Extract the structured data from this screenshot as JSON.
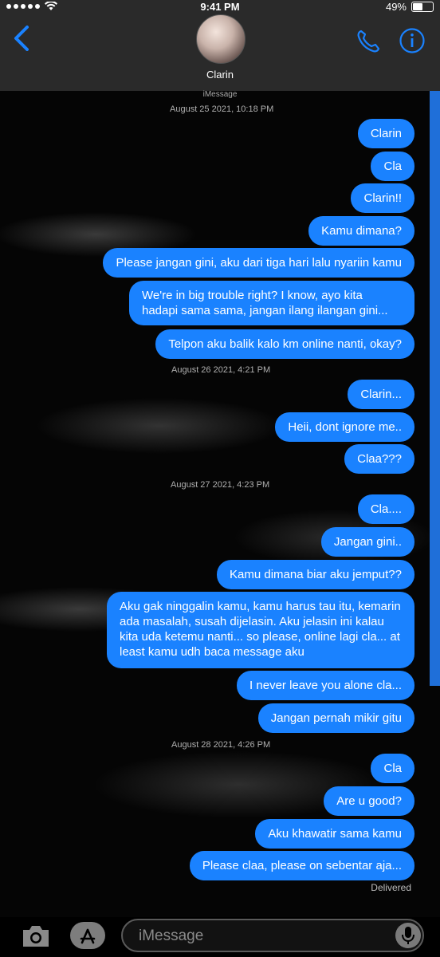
{
  "status_bar": {
    "signal_dots": 5,
    "time": "9:41 PM",
    "battery_text": "49%",
    "battery_level": 0.49
  },
  "header": {
    "contact_name": "Clarin",
    "back_icon": "chevron-left-icon",
    "call_icon": "phone-icon",
    "info_icon": "info-icon"
  },
  "thread": {
    "service_label": "iMessage",
    "delivered_label": "Delivered",
    "groups": [
      {
        "timestamp": "August 25 2021, 10:18 PM",
        "messages": [
          "Clarin",
          "Cla",
          "Clarin!!",
          "Kamu dimana?",
          "Please jangan gini, aku dari tiga hari lalu nyariin kamu",
          "We're in big trouble right? I know, ayo kita hadapi sama sama, jangan ilang ilangan gini...",
          "Telpon aku balik kalo km online nanti, okay?"
        ]
      },
      {
        "timestamp": "August 26 2021, 4:21 PM",
        "messages": [
          "Clarin...",
          "Heii, dont ignore me..",
          "Claa???"
        ]
      },
      {
        "timestamp": "August 27 2021, 4:23 PM",
        "messages": [
          "Cla....",
          "Jangan gini..",
          "Kamu dimana biar aku jemput??",
          "Aku gak ninggalin kamu, kamu harus tau itu, kemarin ada masalah, susah dijelasin. Aku jelasin ini kalau kita uda ketemu nanti... so please, online lagi cla... at least kamu udh baca message aku",
          "I never leave you alone cla...",
          "Jangan pernah mikir gitu"
        ]
      },
      {
        "timestamp": "August 28 2021, 4:26 PM",
        "messages": [
          "Cla",
          "Are u good?",
          "Aku khawatir sama kamu",
          "Please claa, please on sebentar aja..."
        ]
      }
    ]
  },
  "composer": {
    "placeholder": "iMessage",
    "camera_icon": "camera-icon",
    "apps_icon": "app-store-icon",
    "mic_icon": "microphone-icon"
  },
  "colors": {
    "bubble": "#1a82ff",
    "accent": "#1f6fd9",
    "header_bg": "#2a2a2a"
  }
}
